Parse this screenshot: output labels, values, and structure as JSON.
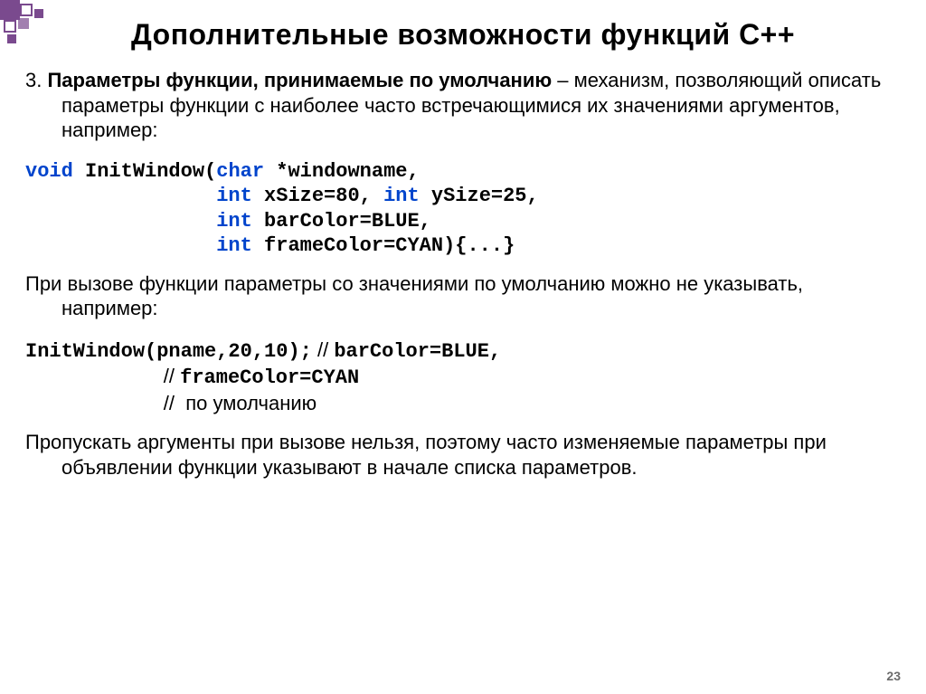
{
  "title": "Дополнительные возможности функций С++",
  "intro": {
    "num": "3. ",
    "bold": "Параметры функции, принимаемые по умолчанию",
    "rest": " – механизм, позволяющий описать параметры функции с наиболее часто встречающимися их значениями аргументов, например:"
  },
  "code1": {
    "l1a": "void",
    "l1b": " InitWindow(",
    "l1c": "char",
    "l1d": " *windowname,",
    "l2a": "                ",
    "l2b": "int",
    "l2c": " xSize=80, ",
    "l2d": "int",
    "l2e": " ySize=25,",
    "l3a": "                ",
    "l3b": "int",
    "l3c": " barColor=BLUE,",
    "l4a": "                ",
    "l4b": "int",
    "l4c": " frameColor=CYAN){...}"
  },
  "mid": "При вызове функции параметры со значениями по умолчанию можно не указывать, например:",
  "code2": {
    "l1a": "InitWindow(pname,20,10);",
    "l1b": " // ",
    "l1c": "barColor=BLUE,",
    "l2a": "                         // ",
    "l2b": "frameColor=CYAN",
    "l3a": "                         //  ",
    "l3b": "по умолчанию"
  },
  "outro": "Пропускать аргументы при вызове нельзя, поэтому часто изменяемые параметры при объявлении функции указывают в начале списка параметров.",
  "pagenum": "23"
}
